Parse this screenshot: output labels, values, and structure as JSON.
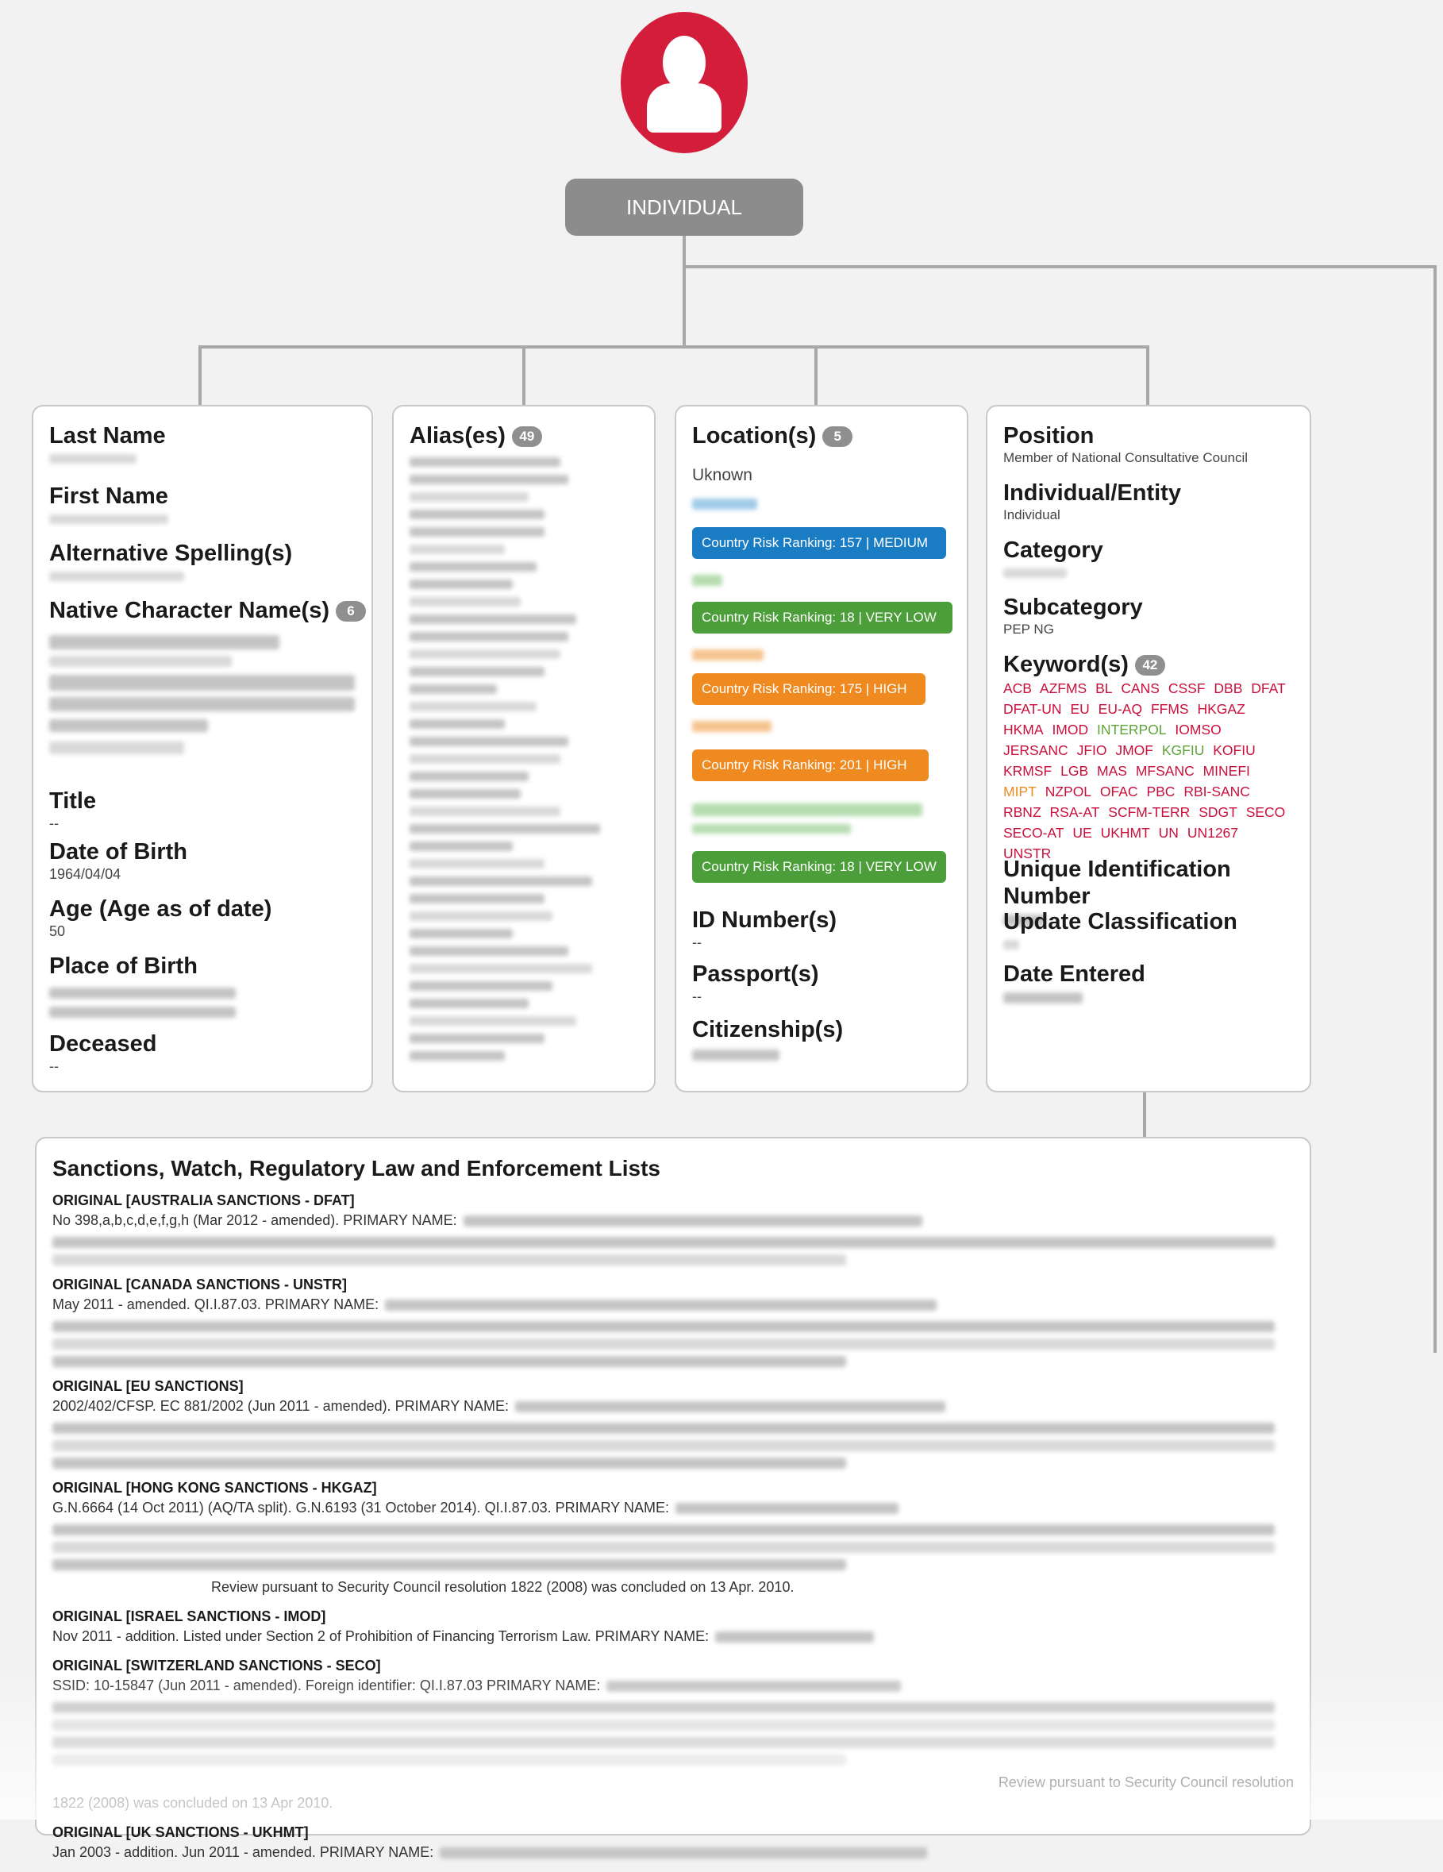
{
  "entity_type": "INDIVIDUAL",
  "colors": {
    "avatar": "#d31d3a",
    "medium": "#1a7cc2",
    "very_low": "#4c9e3a",
    "high": "#ef8a21",
    "keyword_red": "#c8103a",
    "keyword_green": "#5ea43a",
    "keyword_orange": "#ef8a21"
  },
  "personal": {
    "last_name_label": "Last Name",
    "first_name_label": "First Name",
    "alt_spelling_label": "Alternative Spelling(s)",
    "native_label": "Native Character Name(s)",
    "native_count": "6",
    "title_label": "Title",
    "title_value": "--",
    "dob_label": "Date of Birth",
    "dob_value": "1964/04/04",
    "age_label": "Age (Age as of date)",
    "age_value": "50",
    "pob_label": "Place of Birth",
    "deceased_label": "Deceased",
    "deceased_value": "--"
  },
  "aliases": {
    "label": "Alias(es)",
    "count": "49"
  },
  "locations": {
    "label": "Location(s)",
    "count": "5",
    "first": "Uknown",
    "rankings": [
      {
        "text": "Country Risk Ranking: 157 | MEDIUM",
        "level": "medium"
      },
      {
        "text": "Country Risk Ranking: 18 | VERY LOW",
        "level": "very_low"
      },
      {
        "text": "Country Risk Ranking: 175 | HIGH",
        "level": "high"
      },
      {
        "text": "Country Risk Ranking: 201 | HIGH",
        "level": "high"
      },
      {
        "text": "Country Risk Ranking: 18 | VERY LOW",
        "level": "very_low"
      }
    ],
    "id_label": "ID Number(s)",
    "id_value": "--",
    "passport_label": "Passport(s)",
    "passport_value": "--",
    "citizenship_label": "Citizenship(s)"
  },
  "classification": {
    "position_label": "Position",
    "position_value": "Member of National Consultative Council",
    "ind_ent_label": "Individual/Entity",
    "ind_ent_value": "Individual",
    "category_label": "Category",
    "subcategory_label": "Subcategory",
    "subcategory_value": "PEP NG",
    "keywords_label": "Keyword(s)",
    "keywords_count": "42",
    "keywords": [
      [
        "ACB",
        "red"
      ],
      [
        "AZFMS",
        "red"
      ],
      [
        "BL",
        "red"
      ],
      [
        "CANS",
        "red"
      ],
      [
        "CSSF",
        "red"
      ],
      [
        "DBB",
        "red"
      ],
      [
        "DFAT",
        "red"
      ],
      [
        "DFAT-UN",
        "red"
      ],
      [
        "EU",
        "red"
      ],
      [
        "EU-AQ",
        "red"
      ],
      [
        "FFMS",
        "red"
      ],
      [
        "HKGAZ",
        "red"
      ],
      [
        "HKMA",
        "red"
      ],
      [
        "IMOD",
        "red"
      ],
      [
        "INTERPOL",
        "green"
      ],
      [
        "IOMSO",
        "red"
      ],
      [
        "JERSANC",
        "red"
      ],
      [
        "JFIO",
        "red"
      ],
      [
        "JMOF",
        "red"
      ],
      [
        "KGFIU",
        "green"
      ],
      [
        "KOFIU",
        "red"
      ],
      [
        "KRMSF",
        "red"
      ],
      [
        "LGB",
        "red"
      ],
      [
        "MAS",
        "red"
      ],
      [
        "MFSANC",
        "red"
      ],
      [
        "MINEFI",
        "red"
      ],
      [
        "MIPT",
        "orange"
      ],
      [
        "NZPOL",
        "red"
      ],
      [
        "OFAC",
        "red"
      ],
      [
        "PBC",
        "red"
      ],
      [
        "RBI-SANC",
        "red"
      ],
      [
        "RBNZ",
        "red"
      ],
      [
        "RSA-AT",
        "red"
      ],
      [
        "SCFM-TERR",
        "red"
      ],
      [
        "SDGT",
        "red"
      ],
      [
        "SECO",
        "red"
      ],
      [
        "SECO-AT",
        "red"
      ],
      [
        "UE",
        "red"
      ],
      [
        "UKHMT",
        "red"
      ],
      [
        "UN",
        "red"
      ],
      [
        "UN1267",
        "red"
      ],
      [
        "UNSTR",
        "red"
      ]
    ],
    "uid_label": "Unique Identification Number",
    "update_label": "Update Classification",
    "date_entered_label": "Date Entered"
  },
  "sanctions": {
    "title": "Sanctions, Watch, Regulatory Law and Enforcement Lists",
    "entries": [
      {
        "header": "ORIGINAL [AUSTRALIA SANCTIONS - DFAT]",
        "text": "No 398,a,b,c,d,e,f,g,h (Mar 2012 - amended). PRIMARY NAME:",
        "tail": ""
      },
      {
        "header": "ORIGINAL [CANADA SANCTIONS - UNSTR]",
        "text": "May 2011 - amended. QI.I.87.03. PRIMARY NAME:",
        "tail": ""
      },
      {
        "header": "ORIGINAL [EU SANCTIONS]",
        "text": "2002/402/CFSP. EC 881/2002 (Jun 2011 - amended). PRIMARY NAME:",
        "tail": ""
      },
      {
        "header": "ORIGINAL [HONG KONG SANCTIONS - HKGAZ]",
        "text": "G.N.6664 (14 Oct 2011) (AQ/TA split). G.N.6193 (31 October 2014). QI.I.87.03. PRIMARY NAME:",
        "tail": "Review pursuant to Security Council resolution 1822 (2008) was concluded on 13 Apr. 2010."
      },
      {
        "header": "ORIGINAL [ISRAEL SANCTIONS - IMOD]",
        "text": "Nov 2011 - addition. Listed under Section 2 of Prohibition of Financing Terrorism Law. PRIMARY NAME:",
        "tail": ""
      },
      {
        "header": "ORIGINAL [SWITZERLAND SANCTIONS - SECO]",
        "text": "SSID: 10-15847 (Jun 2011 - amended). Foreign identifier: QI.I.87.03 PRIMARY NAME:",
        "tail": "Review pursuant to Security Council resolution",
        "tail2": "1822 (2008) was concluded on 13 Apr 2010."
      },
      {
        "header": "ORIGINAL [UK SANCTIONS - UKHMT]",
        "text": "Jan 2003 - addition. Jun 2011 - amended. PRIMARY NAME:",
        "tail": ""
      }
    ]
  }
}
